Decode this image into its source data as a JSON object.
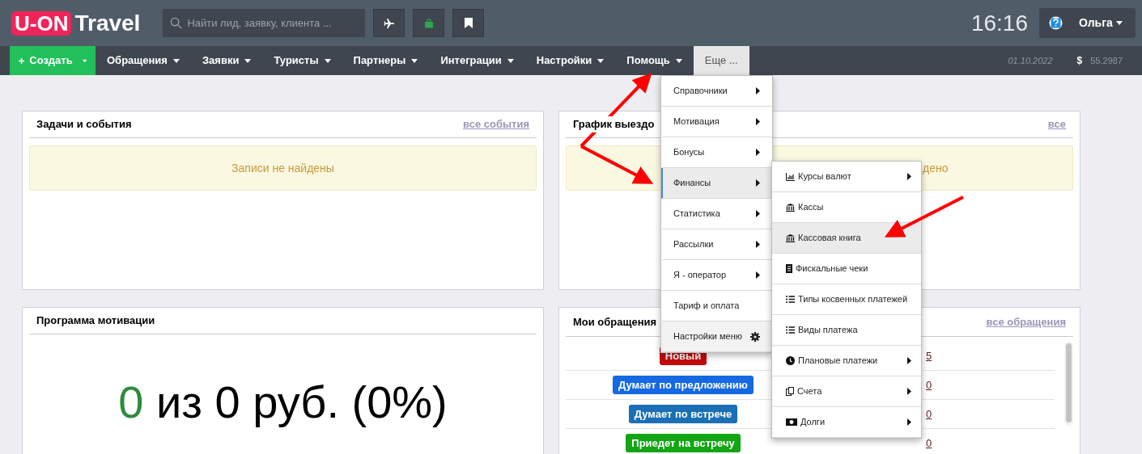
{
  "header": {
    "logo_mark": "U-ON",
    "logo_word": "Travel",
    "search": {
      "placeholder": "Найти лид, заявку, клиента ..."
    },
    "time": "16:16",
    "user": "Ольга"
  },
  "nav": {
    "create": "Создать",
    "items": [
      {
        "label": "Обращения",
        "dropdown": true,
        "selected": false
      },
      {
        "label": "Заявки",
        "dropdown": true,
        "selected": false
      },
      {
        "label": "Туристы",
        "dropdown": true,
        "selected": false
      },
      {
        "label": "Партнеры",
        "dropdown": true,
        "selected": false
      },
      {
        "label": "Интеграции",
        "dropdown": true,
        "selected": false
      },
      {
        "label": "Настройки",
        "dropdown": true,
        "selected": false
      },
      {
        "label": "Помощь",
        "dropdown": true,
        "selected": false
      },
      {
        "label": "Еще ...",
        "dropdown": false,
        "selected": true
      }
    ],
    "date": "01.10.2022",
    "currency_sign": "$",
    "rate": "55.2987"
  },
  "panels": {
    "tasks": {
      "title": "Задачи и события",
      "link": "все события",
      "message": "Записи не найдены"
    },
    "trips": {
      "title": "График выездо",
      "link": "все",
      "message": "дено"
    },
    "motivation": {
      "title": "Программа мотивации",
      "achieved": "0",
      "summary": "из 0 руб. (0%)"
    },
    "requests": {
      "title": "Мои обращения",
      "link": "все обращения",
      "rows": [
        {
          "status": "Новый",
          "color": "#c40a0a",
          "count": "5"
        },
        {
          "status": "Думает по предложению",
          "color": "#1669e0",
          "count": "0"
        },
        {
          "status": "Думает по встрече",
          "color": "#1a6fb5",
          "count": "0"
        },
        {
          "status": "Приедет на встречу",
          "color": "#13a513",
          "count": "0"
        }
      ]
    }
  },
  "more_menu": [
    {
      "label": "Справочники",
      "submenu": true,
      "selected": false,
      "kind": "item"
    },
    {
      "label": "Мотивация",
      "submenu": true,
      "selected": false,
      "kind": "item"
    },
    {
      "label": "Бонусы",
      "submenu": true,
      "selected": false,
      "kind": "item"
    },
    {
      "label": "Финансы",
      "submenu": true,
      "selected": true,
      "kind": "item"
    },
    {
      "label": "Статистика",
      "submenu": true,
      "selected": false,
      "kind": "item"
    },
    {
      "label": "Рассылки",
      "submenu": true,
      "selected": false,
      "kind": "item"
    },
    {
      "label": "Я - оператор",
      "submenu": true,
      "selected": false,
      "kind": "item"
    },
    {
      "label": "Тариф и оплата",
      "submenu": false,
      "selected": false,
      "kind": "item"
    },
    {
      "label": "Настройки меню",
      "submenu": false,
      "selected": false,
      "kind": "settings"
    }
  ],
  "finance_menu": [
    {
      "label": "Курсы валют",
      "submenu": true,
      "selected": false
    },
    {
      "label": "Кассы",
      "submenu": false,
      "selected": false
    },
    {
      "label": "Кассовая книга",
      "submenu": false,
      "selected": true
    },
    {
      "label": "Фискальные чеки",
      "submenu": false,
      "selected": false
    },
    {
      "label": "Типы косвенных платежей",
      "submenu": false,
      "selected": false
    },
    {
      "label": "Виды платежа",
      "submenu": false,
      "selected": false
    },
    {
      "label": "Плановые платежи",
      "submenu": true,
      "selected": false
    },
    {
      "label": "Счета",
      "submenu": true,
      "selected": false
    },
    {
      "label": "Долги",
      "submenu": true,
      "selected": false
    }
  ]
}
